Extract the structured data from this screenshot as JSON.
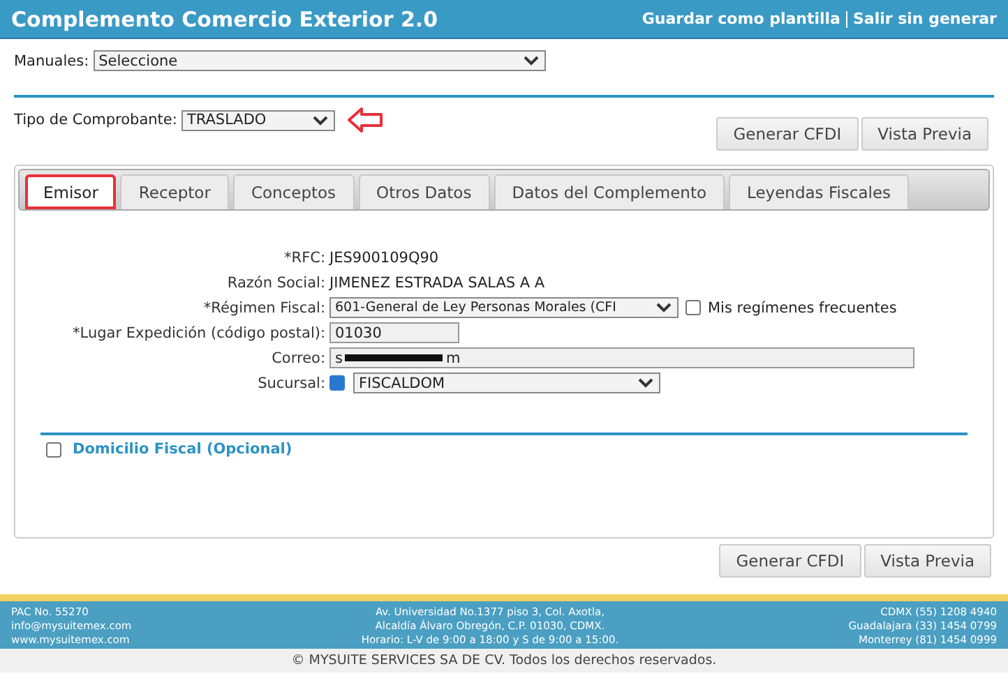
{
  "header": {
    "title": "Complemento Comercio Exterior 2.0",
    "actions": [
      "Guardar como plantilla",
      "Salir sin generar"
    ]
  },
  "manuales": {
    "label": "Manuales:",
    "value": "Seleccione"
  },
  "tipo": {
    "label": "Tipo de Comprobante:",
    "value": "TRASLADO"
  },
  "top_buttons": [
    "Generar CFDI",
    "Vista Previa"
  ],
  "tabs": [
    {
      "label": "Emisor",
      "selected": true,
      "highlighted": true
    },
    {
      "label": "Receptor",
      "selected": false,
      "highlighted": false
    },
    {
      "label": "Conceptos",
      "selected": false,
      "highlighted": false
    },
    {
      "label": "Otros Datos",
      "selected": false,
      "highlighted": false
    },
    {
      "label": "Datos del Complemento",
      "selected": false,
      "highlighted": false
    },
    {
      "label": "Leyendas Fiscales",
      "selected": false,
      "highlighted": false
    }
  ],
  "fields": [
    {
      "kind": "text",
      "label": "*RFC:",
      "value": "JES900109Q90"
    },
    {
      "kind": "text",
      "label": "Razón Social:",
      "value": "JIMENEZ ESTRADA SALAS A A"
    },
    {
      "kind": "select",
      "label": "*Régimen Fiscal:",
      "value": "601-General de Ley Personas Morales (CFI",
      "checkbox": {
        "label": "Mis regímenes frecuentes",
        "checked": false
      }
    },
    {
      "kind": "input",
      "label": "*Lugar Expedición (código postal):",
      "value": "01030"
    },
    {
      "kind": "redacted",
      "label": "Correo:",
      "value_start": "s",
      "value_end": "m"
    },
    {
      "kind": "checkselect",
      "label": "Sucursal:",
      "checked": true,
      "value": "FISCALDOM"
    }
  ],
  "domicilio": {
    "label": "Domicilio Fiscal (Opcional)",
    "checked": false
  },
  "bottom_buttons": [
    "Generar CFDI",
    "Vista Previa"
  ],
  "footer": {
    "left": [
      "PAC No. 55270",
      "info@mysuitemex.com",
      "www.mysuitemex.com"
    ],
    "center": [
      "Av. Universidad No.1377 piso 3, Col. Axotla,",
      "Alcaldía Álvaro Obregón, C.P. 01030, CDMX.",
      "Horario: L-V de 9:00 a 18:00 y S de 9:00 a 15:00."
    ],
    "right": [
      "CDMX (55) 1208 4940",
      "Guadalajara (33) 1454 0799",
      "Monterrey (81) 1454 0999"
    ],
    "copyright": "© MYSUITE SERVICES SA DE CV. Todos los derechos reservados."
  }
}
